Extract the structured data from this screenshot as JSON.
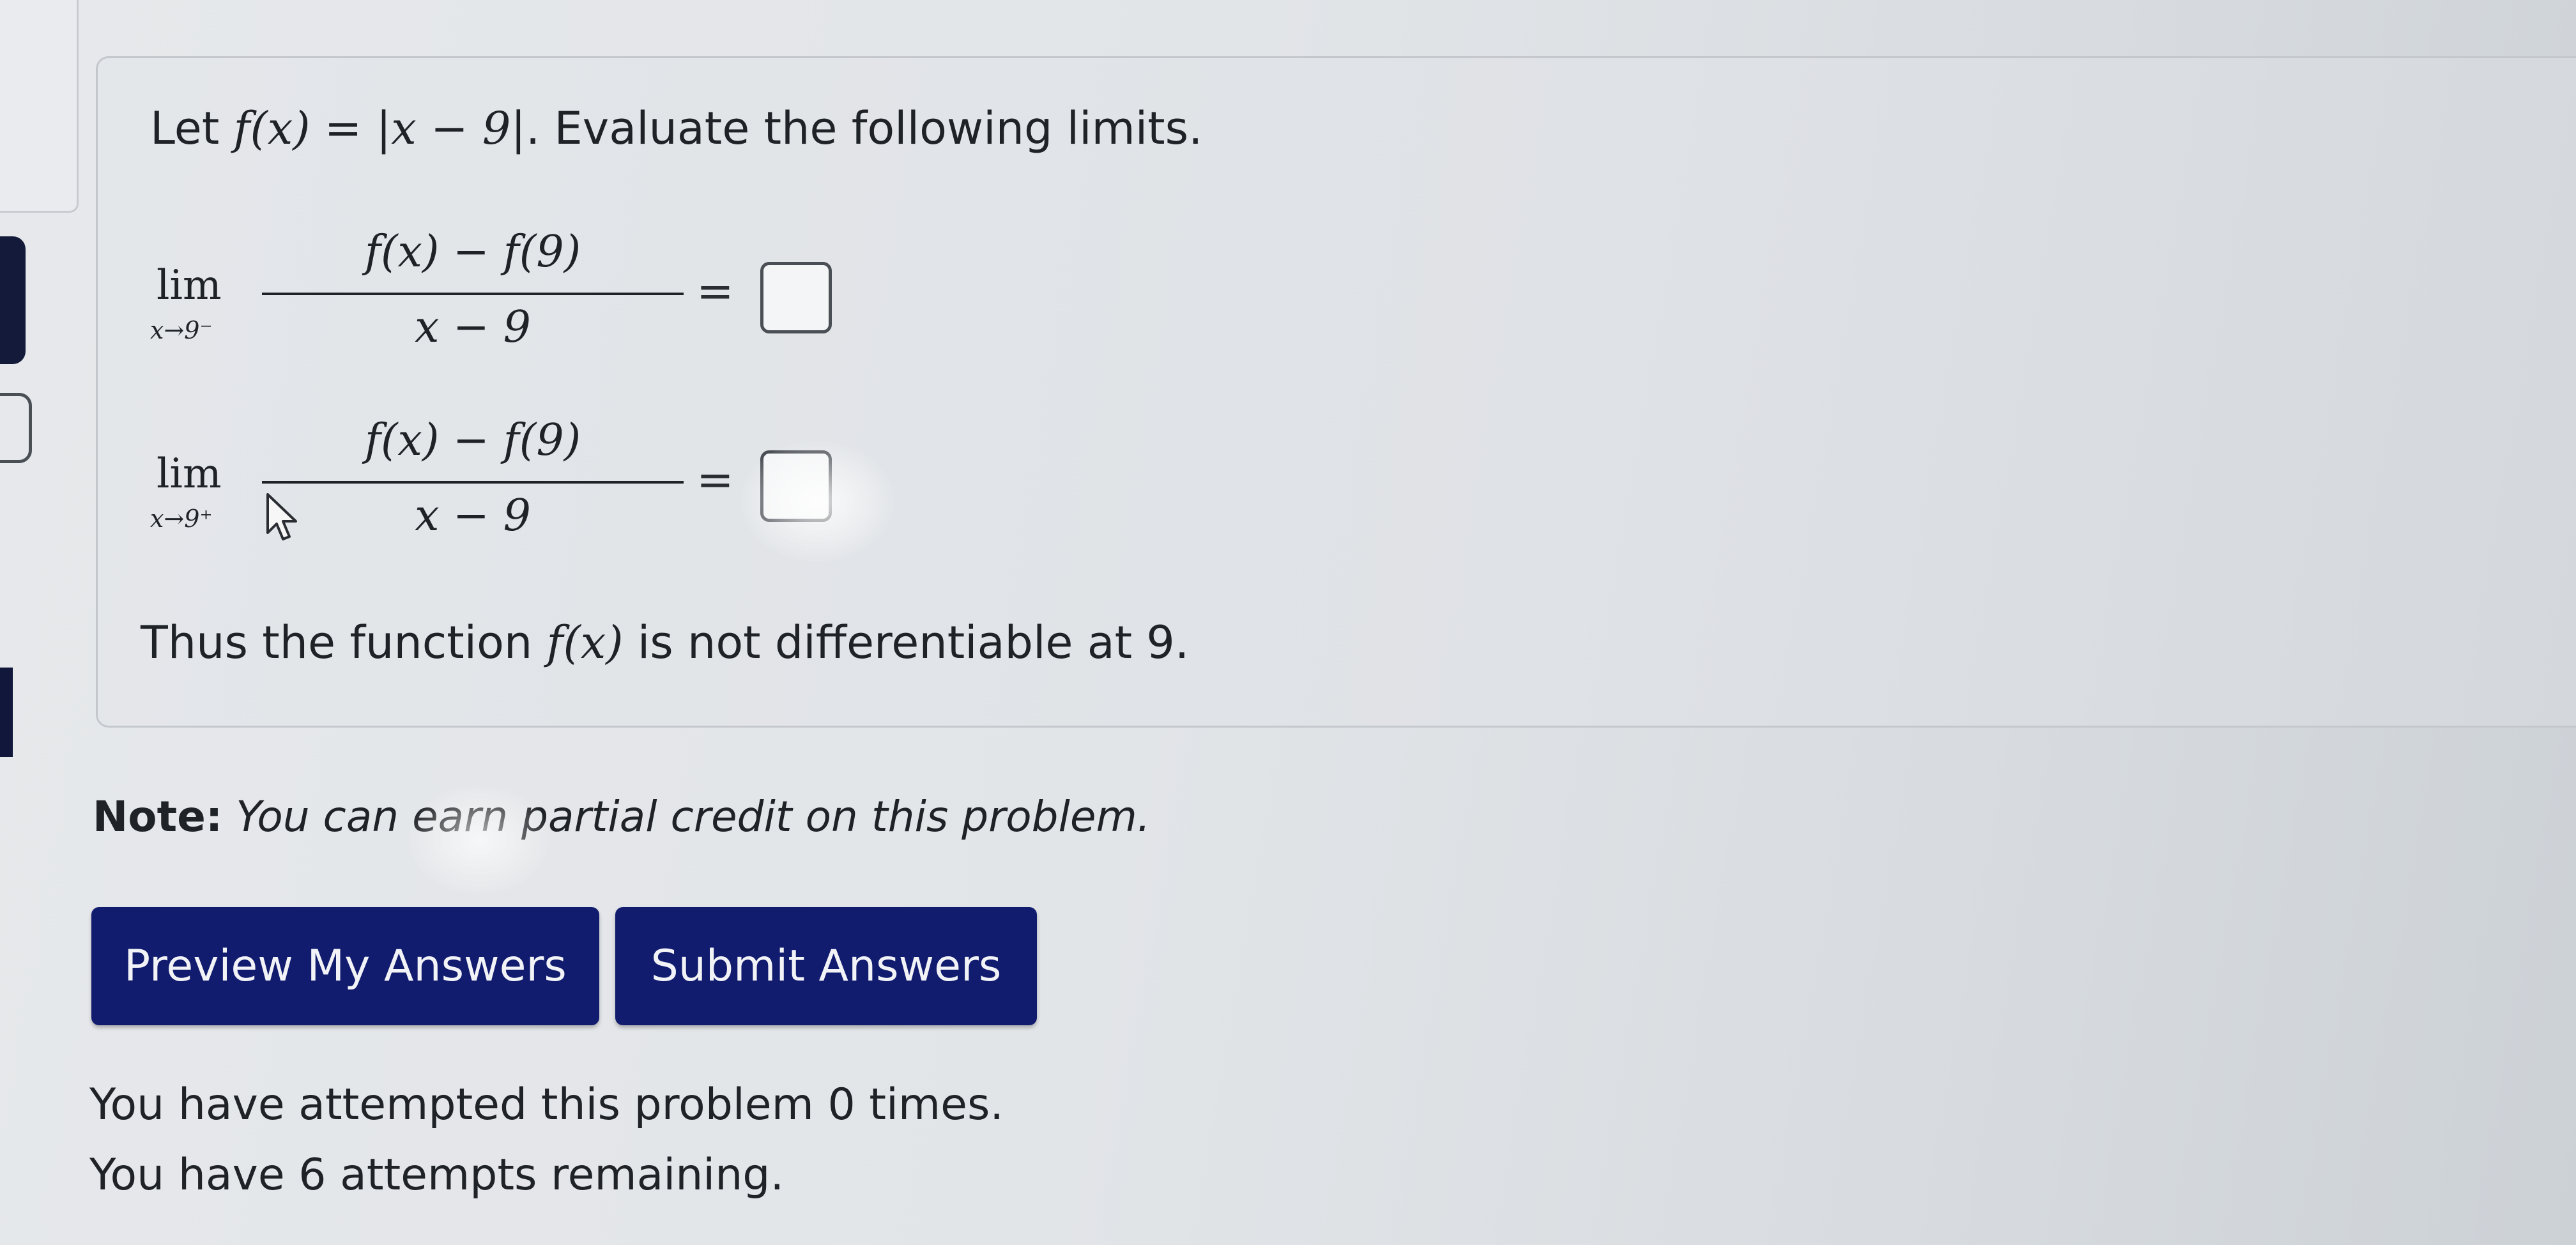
{
  "problem": {
    "statement_prefix": "Let ",
    "statement_function": "f(x) = |x − 9|",
    "statement_suffix": ". Evaluate the following limits.",
    "limits": [
      {
        "lim_word": "lim",
        "subscript": "x→9⁻",
        "numerator": "f(x) − f(9)",
        "denominator": "x − 9",
        "equals": "=",
        "answer": ""
      },
      {
        "lim_word": "lim",
        "subscript": "x→9⁺",
        "numerator": "f(x) − f(9)",
        "denominator": "x − 9",
        "equals": "=",
        "answer": ""
      }
    ],
    "conclusion_prefix": "Thus the function ",
    "conclusion_function": "f(x)",
    "conclusion_suffix": " is not differentiable at 9."
  },
  "note": {
    "label": "Note:",
    "text": "You can earn partial credit on this problem."
  },
  "buttons": {
    "preview": "Preview My Answers",
    "submit": "Submit Answers"
  },
  "attempts": {
    "line1": "You have attempted this problem 0 times.",
    "line2": "You have 6 attempts remaining."
  },
  "colors": {
    "button_bg": "#121c6e",
    "button_text": "#f2f3f7",
    "page_bg": "#e4e7ea"
  },
  "icons": {
    "cursor": "arrow-pointer-icon"
  }
}
